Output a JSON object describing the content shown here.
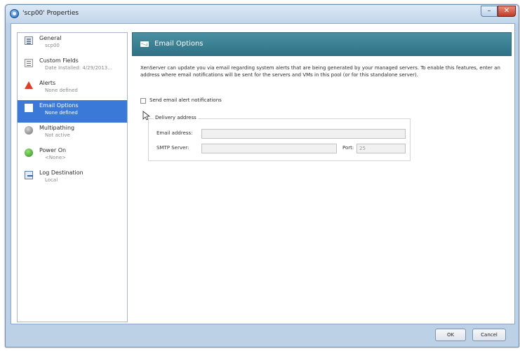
{
  "window": {
    "title": "'scp00' Properties",
    "minimize_label": "–",
    "close_label": "✕"
  },
  "sidebar": {
    "items": [
      {
        "label": "General",
        "sub": "scp00",
        "icon": "general-icon"
      },
      {
        "label": "Custom Fields",
        "sub": "Date Installed: 4/29/2013...",
        "icon": "custom-fields-icon"
      },
      {
        "label": "Alerts",
        "sub": "None defined",
        "icon": "alert-icon"
      },
      {
        "label": "Email Options",
        "sub": "None defined",
        "icon": "email-icon",
        "selected": true
      },
      {
        "label": "Multipathing",
        "sub": "Not active",
        "icon": "multipathing-icon"
      },
      {
        "label": "Power On",
        "sub": "<None>",
        "icon": "power-on-icon"
      },
      {
        "label": "Log Destination",
        "sub": "Local",
        "icon": "log-destination-icon"
      }
    ]
  },
  "main": {
    "header_title": "Email Options",
    "description": "XenServer can update you via email regarding system alerts that are being generated by your managed servers. To enable this features, enter an address where email notifications will be sent for the servers and VMs in this pool (or for this standalone server).",
    "checkbox_label": "Send email alert notifications",
    "checkbox_checked": false,
    "group_title": "Delivery address",
    "email_label": "Email address:",
    "email_value": "",
    "smtp_label": "SMTP Server:",
    "smtp_value": "",
    "port_label": "Port:",
    "port_value": "25"
  },
  "footer": {
    "ok_label": "OK",
    "cancel_label": "Cancel"
  },
  "colors": {
    "header_bg": "#2f7287",
    "selection": "#3b79d8",
    "window_frame": "#bcd0e6"
  }
}
